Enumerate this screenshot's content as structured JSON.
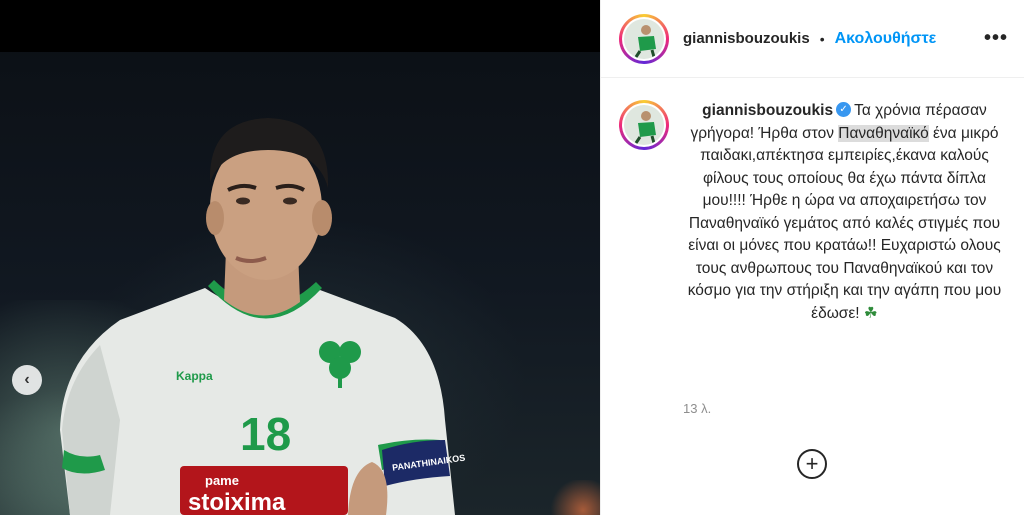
{
  "post": {
    "username": "giannisbouzoukis",
    "follow_label": "Ακολουθήστε",
    "separator": "•",
    "more_label": "•••",
    "caption_before": "Τα χρόνια πέρασαν γρήγορα! Ήρθα στον ",
    "caption_highlight": "Παναθηναϊκό",
    "caption_after": " ένα μικρό παιδακι,απέκτησα εμπειρίες,έκανα καλούς φίλους τους οποίους θα έχω πάντα δίπλα μου!!!! Ήρθε η ώρα να αποχαιρετήσω τον Παναθηναϊκό γεμάτος από καλές στιγμές που είναι οι μόνες που κρατάω!! Ευχαριστώ ολους τους ανθρωπους του Παναθηναϊκού και τον κόσμο για την στήριξη και την αγάπη που μου έδωσε! ",
    "caption_emoji": "☘",
    "verified_mark": "✓",
    "timestamp": "13 λ.",
    "add_comment_label": "+"
  },
  "photo": {
    "sponsor_top": "pame",
    "sponsor_main": "stoixima",
    "brand": "Kappa",
    "jersey_number": "18",
    "armband_text": "PANATHINAIKOS",
    "prev_label": "‹"
  },
  "colors": {
    "accent": "#0095f6",
    "verified": "#3897f0",
    "jersey_green": "#1f9a4a",
    "jersey_white": "#e9ece9"
  }
}
